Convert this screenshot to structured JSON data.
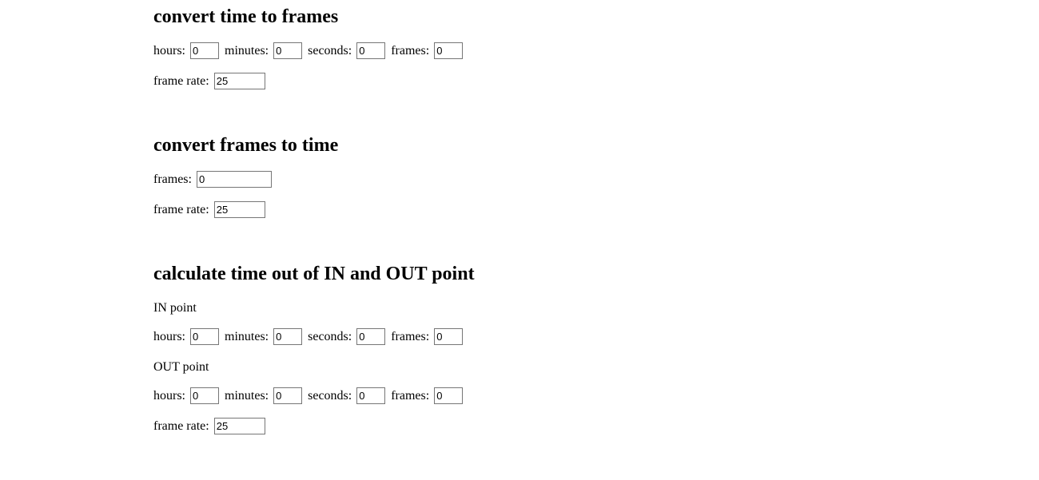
{
  "section1": {
    "title": "convert time to frames",
    "hours_label": "hours:",
    "hours_value": "0",
    "minutes_label": "minutes:",
    "minutes_value": "0",
    "seconds_label": "seconds:",
    "seconds_value": "0",
    "frames_label": "frames:",
    "frames_value": "0",
    "rate_label": "frame rate:",
    "rate_value": "25"
  },
  "section2": {
    "title": "convert frames to time",
    "frames_label": "frames:",
    "frames_value": "0",
    "rate_label": "frame rate:",
    "rate_value": "25"
  },
  "section3": {
    "title": "calculate time out of IN and OUT point",
    "in_label": "IN point",
    "in": {
      "hours_label": "hours:",
      "hours_value": "0",
      "minutes_label": "minutes:",
      "minutes_value": "0",
      "seconds_label": "seconds:",
      "seconds_value": "0",
      "frames_label": "frames:",
      "frames_value": "0"
    },
    "out_label": "OUT point",
    "out": {
      "hours_label": "hours:",
      "hours_value": "0",
      "minutes_label": "minutes:",
      "minutes_value": "0",
      "seconds_label": "seconds:",
      "seconds_value": "0",
      "frames_label": "frames:",
      "frames_value": "0"
    },
    "rate_label": "frame rate:",
    "rate_value": "25"
  }
}
